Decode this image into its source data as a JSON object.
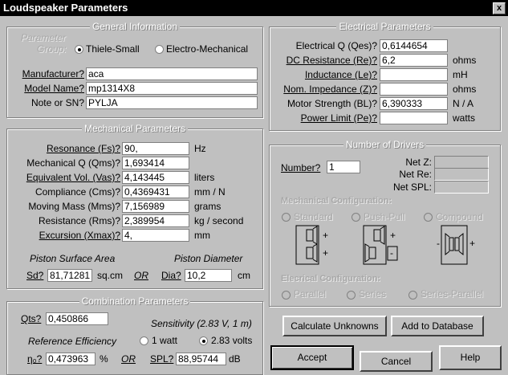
{
  "window": {
    "title": "Loudspeaker Parameters",
    "close": "x"
  },
  "general": {
    "legend": "General Information",
    "param_label": "Parameter",
    "group_label": "Group:",
    "opt_ts": "Thiele-Small",
    "opt_em": "Electro-Mechanical",
    "selected": "Thiele-Small",
    "manufacturer_label": "Manufacturer?",
    "manufacturer": "aca",
    "model_label": "Model Name?",
    "model": "mp1314X8",
    "note_label": "Note or SN?",
    "note": "PYLJA"
  },
  "mechanical": {
    "legend": "Mechanical Parameters",
    "rows": [
      {
        "label": "Resonance (Fs)?",
        "value": "90,",
        "unit": "Hz"
      },
      {
        "label": "Mechanical Q (Qms)?",
        "value": "1,693414",
        "unit": ""
      },
      {
        "label": "Equivalent Vol. (Vas)?",
        "value": "4,143445",
        "unit": "liters"
      },
      {
        "label": "Compliance (Cms)?",
        "value": "0,4369431",
        "unit": "mm / N"
      },
      {
        "label": "Moving Mass (Mms)?",
        "value": "7,156989",
        "unit": "grams"
      },
      {
        "label": "Resistance (Rms)?",
        "value": "2,389954",
        "unit": "kg / second"
      },
      {
        "label": "Excursion (Xmax)?",
        "value": "4,",
        "unit": "mm"
      }
    ],
    "piston_area_label": "Piston Surface Area",
    "piston_dia_label": "Piston Diameter",
    "sd_label": "Sd?",
    "sd": "81,71281",
    "sd_unit": "sq.cm",
    "or": "OR",
    "dia_label": "Dia?",
    "dia": "10,2",
    "dia_unit": "cm"
  },
  "combination": {
    "legend": "Combination Parameters",
    "qts_label": "Qts?",
    "qts": "0,450866",
    "sens_label": "Sensitivity (2.83 V, 1 m)",
    "ref_eff_label": "Reference Efficiency",
    "opt_1w": "1 watt",
    "opt_283": "2.83 volts",
    "selected": "2.83 volts",
    "n0_label": "η₀?",
    "n0": "0,473963",
    "pct": "%",
    "or": "OR",
    "spl_label": "SPL?",
    "spl": "88,95744",
    "spl_unit": "dB"
  },
  "electrical": {
    "legend": "Electrical Parameters",
    "rows": [
      {
        "label": "Electrical Q (Qes)?",
        "value": "0,6144654",
        "unit": ""
      },
      {
        "label": "DC Resistance (Re)?",
        "value": "6,2",
        "unit": "ohms"
      },
      {
        "label": "Inductance (Le)?",
        "value": "",
        "unit": "mH"
      },
      {
        "label": "Nom. Impedance (Z)?",
        "value": "",
        "unit": "ohms"
      },
      {
        "label": "Motor Strength (BL)?",
        "value": "6,390333",
        "unit": "N / A"
      },
      {
        "label": "Power Limit (Pe)?",
        "value": "",
        "unit": "watts"
      }
    ]
  },
  "drivers": {
    "legend": "Number of Drivers",
    "number_label": "Number?",
    "number": "1",
    "net_z": "Net Z:",
    "net_re": "Net Re:",
    "net_spl": "Net SPL:",
    "mech_config_label": "Mechanical Configuration:",
    "opt_standard": "Standard",
    "opt_pushpull": "Push-Pull",
    "opt_compound": "Compound",
    "elec_config_label": "Elecrical Configuration:",
    "opt_parallel": "Parallel",
    "opt_series": "Series",
    "opt_series_parallel": "Series-Parallel",
    "plus": "+",
    "minus": "-"
  },
  "buttons": {
    "calculate": "Calculate Unknowns",
    "add_db": "Add to Database",
    "accept": "Accept",
    "cancel": "Cancel",
    "help": "Help"
  }
}
